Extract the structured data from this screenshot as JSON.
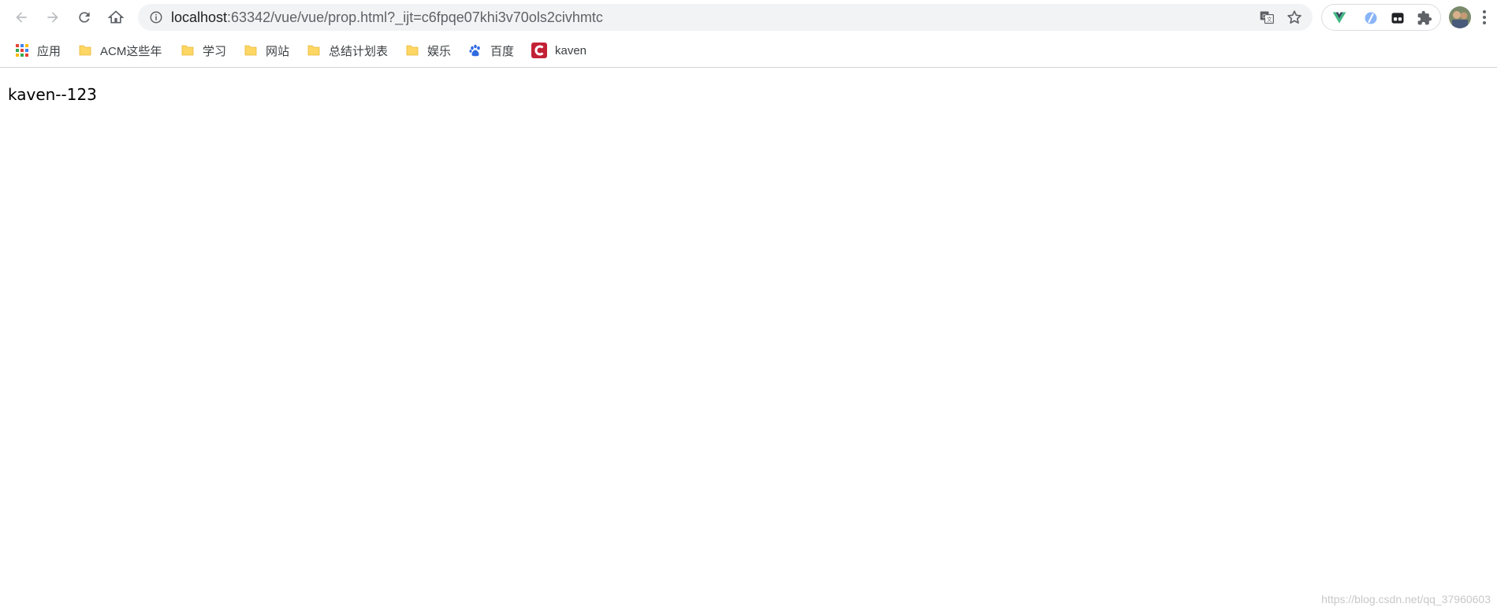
{
  "browser": {
    "url_host": "localhost",
    "url_path": ":63342/vue/vue/prop.html?_ijt=c6fpqe07khi3v70ols2civhmtc",
    "nav_icons": [
      "back-icon",
      "forward-icon",
      "reload-icon",
      "home-icon"
    ],
    "omnibox_icons": [
      "info-icon",
      "translate-icon",
      "star-icon"
    ],
    "extensions": [
      "vue-devtools-icon",
      "tampermonkey-like-icon",
      "extension-dark-icon",
      "puzzle-icon"
    ],
    "menu_icon": "kebab-menu-icon"
  },
  "bookmarks": [
    {
      "label": "应用",
      "icon": "apps-grid-icon"
    },
    {
      "label": "ACM这些年",
      "icon": "folder-icon"
    },
    {
      "label": "学习",
      "icon": "folder-icon"
    },
    {
      "label": "网站",
      "icon": "folder-icon"
    },
    {
      "label": "总结计划表",
      "icon": "folder-icon"
    },
    {
      "label": "娱乐",
      "icon": "folder-icon"
    },
    {
      "label": "百度",
      "icon": "baidu-paw-icon"
    },
    {
      "label": "kaven",
      "icon": "csdn-icon"
    }
  ],
  "page": {
    "text": "kaven--123"
  },
  "watermark": "https://blog.csdn.net/qq_37960603",
  "colors": {
    "omnibox_bg": "#f1f3f4",
    "folder": "#fdd663",
    "csdn_red": "#c32136",
    "baidu_blue": "#2f6ae0",
    "vue_green": "#41b883"
  }
}
